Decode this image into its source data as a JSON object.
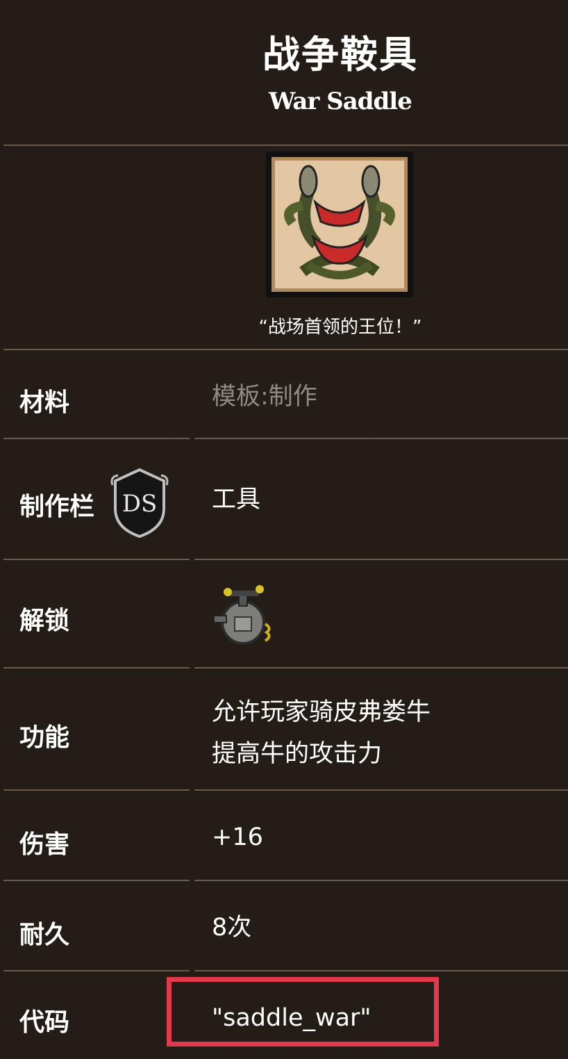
{
  "header": {
    "title_cn": "战争鞍具",
    "title_en": "War Saddle"
  },
  "image": {
    "icon": "war-saddle-icon",
    "quote": "“战场首领的王位！”"
  },
  "rows": {
    "material": {
      "label": "材料",
      "value": "模板:制作"
    },
    "craft_tab": {
      "label": "制作栏",
      "badge": "DS",
      "value": "工具"
    },
    "unlock": {
      "label": "解锁",
      "icon": "science-machine-icon"
    },
    "function": {
      "label": "功能",
      "line1": "允许玩家骑皮弗娄牛",
      "line2": "提高牛的攻击力"
    },
    "damage": {
      "label": "伤害",
      "value": "+16"
    },
    "durability": {
      "label": "耐久",
      "value": "8次"
    },
    "code": {
      "label": "代码",
      "value": "\"saddle_war\""
    }
  },
  "colors": {
    "background": "#241d17",
    "divider": "#6d5b4a",
    "highlight": "#e5384a",
    "muted_text": "#8f8a85"
  }
}
